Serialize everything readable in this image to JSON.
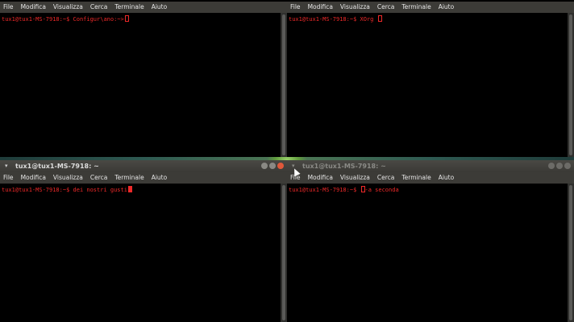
{
  "menu": [
    "File",
    "Modifica",
    "Visualizza",
    "Cerca",
    "Terminale",
    "Aiuto"
  ],
  "windows": {
    "top_left": {
      "prompt": "tux1@tux1-MS-7918:~$ ",
      "command": "Configur\\ano:~>"
    },
    "top_right": {
      "prompt": "tux1@tux1-MS-7918:~$ ",
      "command": "XOrg "
    },
    "bottom_left": {
      "title": "tux1@tux1-MS-7918: ~",
      "prompt": "tux1@tux1-MS-7918:~$ ",
      "command": "dei nostri gusti"
    },
    "bottom_right": {
      "title": "tux1@tux1-MS-7918: ~",
      "prompt": "tux1@tux1-MS-7918:~$ ",
      "command": "-a seconda"
    }
  },
  "colors": {
    "prompt": "#ef2929",
    "menubar": "#3c3b37",
    "close_button": "#e0583a"
  }
}
